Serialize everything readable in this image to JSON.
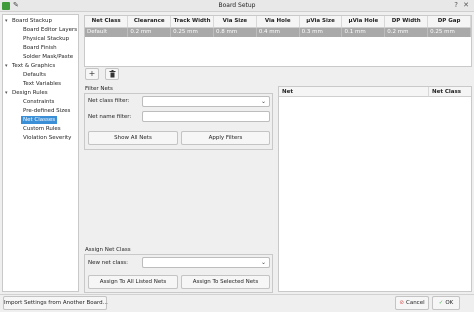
{
  "window": {
    "title": "Board Setup"
  },
  "sidebar": {
    "items": [
      {
        "label": "Board Stackup",
        "expanded": true
      },
      {
        "label": "Board Editor Layers"
      },
      {
        "label": "Physical Stackup"
      },
      {
        "label": "Board Finish"
      },
      {
        "label": "Solder Mask/Paste"
      },
      {
        "label": "Text & Graphics",
        "expanded": true
      },
      {
        "label": "Defaults"
      },
      {
        "label": "Text Variables"
      },
      {
        "label": "Design Rules",
        "expanded": true
      },
      {
        "label": "Constraints"
      },
      {
        "label": "Pre-defined Sizes"
      },
      {
        "label": "Net Classes",
        "selected": true
      },
      {
        "label": "Custom Rules"
      },
      {
        "label": "Violation Severity"
      }
    ]
  },
  "net_class_table": {
    "columns": [
      "Net Class",
      "Clearance",
      "Track Width",
      "Via Size",
      "Via Hole",
      "μVia Size",
      "μVia Hole",
      "DP Width",
      "DP Gap"
    ],
    "rows": [
      [
        "Default",
        "0.2 mm",
        "0.25 mm",
        "0.8 mm",
        "0.4 mm",
        "0.3 mm",
        "0.1 mm",
        "0.2 mm",
        "0.25 mm"
      ]
    ]
  },
  "toolbar": {
    "add_icon": "plus-icon",
    "delete_icon": "trash-icon"
  },
  "filter_nets": {
    "title": "Filter Nets",
    "net_class_filter_label": "Net class filter:",
    "net_class_filter_value": "",
    "net_name_filter_label": "Net name filter:",
    "net_name_filter_value": "",
    "show_all_label": "Show All Nets",
    "apply_label": "Apply Filters"
  },
  "assign_net_class": {
    "title": "Assign Net Class",
    "new_net_class_label": "New net class:",
    "new_net_class_value": "",
    "assign_all_label": "Assign To All Listed Nets",
    "assign_selected_label": "Assign To Selected Nets"
  },
  "net_list": {
    "columns": [
      "Net",
      "Net Class"
    ]
  },
  "footer": {
    "import_label": "Import Settings from Another Board...",
    "cancel_label": "Cancel",
    "ok_label": "OK"
  },
  "colors": {
    "selection": "#3a8fd7",
    "cancel_icon": "#d9534f",
    "ok_icon": "#4caf50"
  }
}
